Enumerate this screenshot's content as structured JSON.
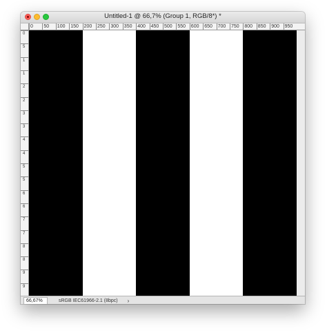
{
  "window": {
    "title": "Untitled-1 @ 66,7% (Group 1, RGB/8*) *"
  },
  "ruler": {
    "top_labels": [
      "0",
      "50",
      "100",
      "150",
      "200",
      "250",
      "300",
      "350",
      "400",
      "450",
      "500",
      "550",
      "600",
      "650",
      "700",
      "750",
      "800",
      "850",
      "900",
      "950"
    ],
    "left_labels": [
      "0",
      "5",
      "1",
      "1",
      "2",
      "2",
      "3",
      "3",
      "4",
      "4",
      "5",
      "5",
      "6",
      "6",
      "7",
      "7",
      "8",
      "8",
      "9",
      "9"
    ]
  },
  "canvas": {
    "background": "#ffffff",
    "stripe_color": "#000000",
    "stripes": [
      "black",
      "white",
      "black",
      "white",
      "black"
    ]
  },
  "status": {
    "zoom": "66,67%",
    "profile": "sRGB IEC61966-2.1 (8bpc)",
    "arrow": "›"
  },
  "icons": {
    "close": "close-icon",
    "minimize": "minimize-icon",
    "zoom": "zoom-icon"
  }
}
